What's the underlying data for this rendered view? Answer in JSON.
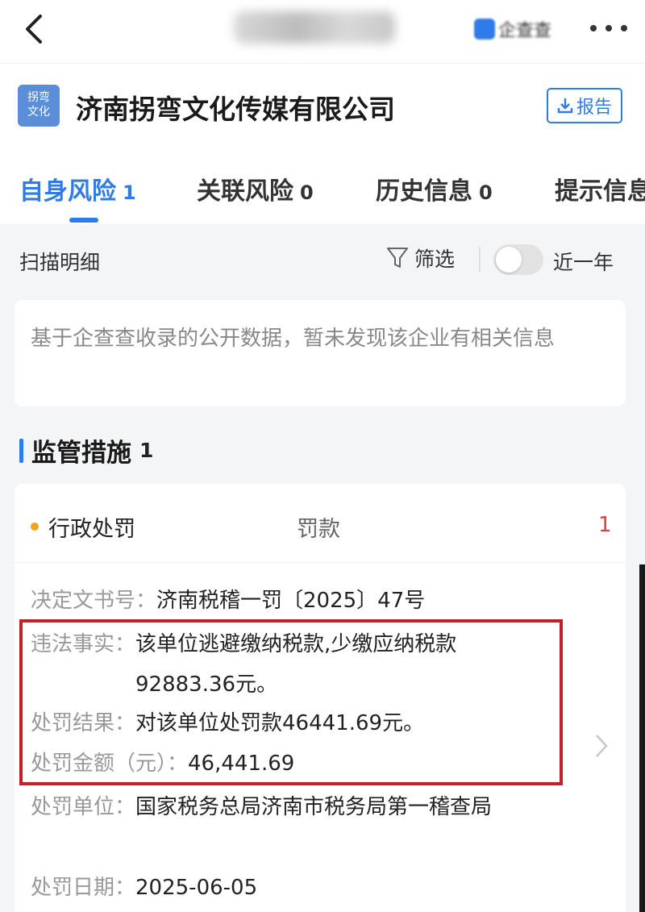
{
  "header": {
    "back_icon": "chevron-left-icon",
    "app_logo_text": "企查查",
    "more_icon": "more-dots-icon"
  },
  "company": {
    "logo_line1": "拐弯",
    "logo_line2": "文化",
    "name": "济南拐弯文化传媒有限公司",
    "report_label": "报告",
    "report_icon": "download-icon"
  },
  "tabs": [
    {
      "label": "自身风险",
      "count": "1",
      "active": true
    },
    {
      "label": "关联风险",
      "count": "0",
      "active": false
    },
    {
      "label": "历史信息",
      "count": "0",
      "active": false
    },
    {
      "label": "提示信息",
      "count": "",
      "active": false
    }
  ],
  "toolbar": {
    "scan_label": "扫描明细",
    "filter_label": "筛选",
    "filter_icon": "filter-funnel-icon",
    "toggle_label": "近一年",
    "toggle_on": false
  },
  "notice": {
    "text": "基于企查查收录的公开数据，暂未发现该企业有相关信息"
  },
  "section": {
    "title": "监管措施",
    "count": "1"
  },
  "card": {
    "type": "行政处罚",
    "subtype": "罚款",
    "count": "1",
    "fields": [
      {
        "key": "决定文书号：",
        "value": "济南税稽一罚〔2025〕47号"
      },
      {
        "key": "违法事实：",
        "value": "该单位逃避缴纳税款,少缴应纳税款92883.36元。"
      },
      {
        "key": "处罚结果：",
        "value": "对该单位处罚款46441.69元。"
      },
      {
        "key": "处罚金额（元）：",
        "value": "46,441.69"
      },
      {
        "key": "处罚单位：",
        "value": "国家税务总局济南市税务局第一稽查局"
      },
      {
        "key": "处罚日期：",
        "value": "2025-06-05"
      }
    ]
  },
  "colors": {
    "accent": "#2f7be8",
    "highlight_border": "#c0202a",
    "count_red": "#e0403a",
    "dot_orange": "#f2a31a"
  }
}
